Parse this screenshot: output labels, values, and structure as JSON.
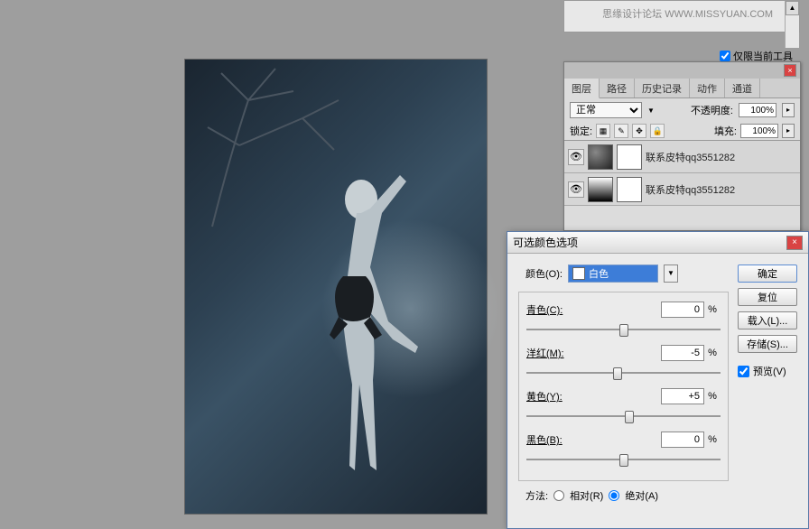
{
  "watermark": "思缘设计论坛  WWW.MISSYUAN.COM",
  "tool_only_checkbox": "仅限当前工具",
  "layers_panel": {
    "tabs": [
      "图层",
      "路径",
      "历史记录",
      "动作",
      "通道"
    ],
    "blend_mode": "正常",
    "opacity_label": "不透明度:",
    "opacity_value": "100%",
    "lock_label": "锁定:",
    "fill_label": "填充:",
    "fill_value": "100%",
    "layers": [
      {
        "name": "联系皮特qq3551282"
      },
      {
        "name": "联系皮特qq3551282"
      }
    ]
  },
  "selcolor": {
    "title": "可选颜色选项",
    "color_label": "颜色(O):",
    "color_selected": "白色",
    "sliders": [
      {
        "label": "青色(C):",
        "value": "0",
        "pos": 50
      },
      {
        "label": "洋红(M):",
        "value": "-5",
        "pos": 47
      },
      {
        "label": "黄色(Y):",
        "value": "+5",
        "pos": 53
      },
      {
        "label": "黑色(B):",
        "value": "0",
        "pos": 50
      }
    ],
    "method_label": "方法:",
    "relative_label": "相对(R)",
    "absolute_label": "绝对(A)",
    "buttons": {
      "ok": "确定",
      "cancel": "复位",
      "load": "载入(L)...",
      "save": "存储(S)...",
      "preview": "预览(V)"
    }
  }
}
